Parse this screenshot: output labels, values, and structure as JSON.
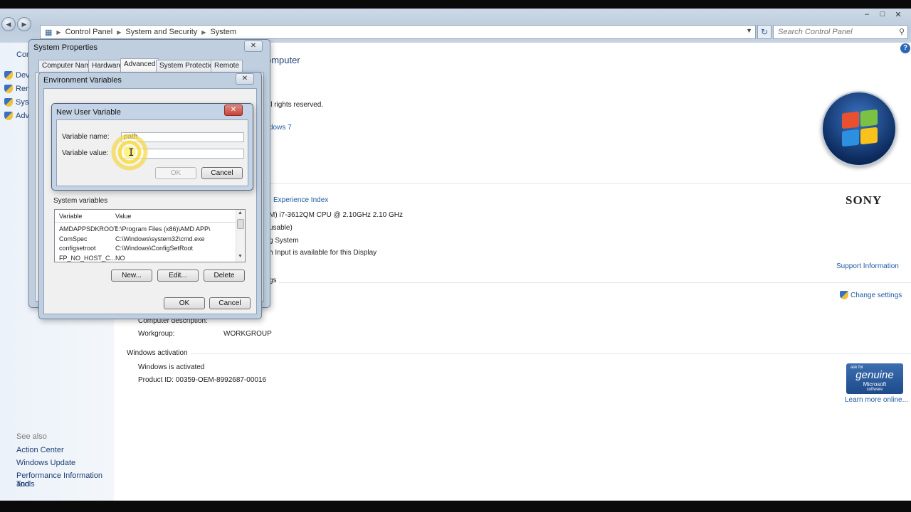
{
  "explorer": {
    "breadcrumb": [
      "Control Panel",
      "System and Security",
      "System"
    ],
    "search_placeholder": "Search Control Panel"
  },
  "left_pane": {
    "items": [
      "Devi",
      "Rem",
      "Syst",
      "Adv"
    ],
    "see_also_heading": "See also",
    "see_also": [
      "Action Center",
      "Windows Update",
      "Performance Information and",
      "Tools"
    ]
  },
  "main": {
    "heading_fragment": "omputer",
    "copyright_fragment": "ll rights reserved.",
    "sp_link_fragment": "dows 7",
    "wei_link_fragment": "Experience Index",
    "processor": "M) i7-3612QM CPU @ 2.10GHz   2.10 GHz",
    "ram_fragment": "usable)",
    "system_type_fragment": "g System",
    "pen_fragment": "h Input is available for this Display",
    "settings_fragment": "gs",
    "support_link": "Support Information",
    "change_settings": "Change settings",
    "brand": "SONY",
    "computer_description_label": "Computer description:",
    "workgroup_label": "Workgroup:",
    "workgroup_value": "WORKGROUP",
    "activation_heading": "Windows activation",
    "activation_status": "Windows is activated",
    "product_id": "Product ID: 00359-OEM-8992687-00016",
    "learn_more": "Learn more online...",
    "genuine": {
      "small": "ask for",
      "big": "genuine",
      "ms": "Microsoft",
      "sw": "software"
    }
  },
  "system_properties": {
    "title": "System Properties",
    "tabs": [
      "Computer Name",
      "Hardware",
      "Advanced",
      "System Protection",
      "Remote"
    ],
    "active_tab": "Advanced"
  },
  "env_vars": {
    "title": "Environment Variables",
    "system_vars_label": "System variables",
    "columns": [
      "Variable",
      "Value"
    ],
    "rows": [
      {
        "variable": "AMDAPPSDKROOT",
        "value": "c:\\Program Files (x86)\\AMD APP\\"
      },
      {
        "variable": "ComSpec",
        "value": "C:\\Windows\\system32\\cmd.exe"
      },
      {
        "variable": "configsetroot",
        "value": "C:\\Windows\\ConfigSetRoot"
      },
      {
        "variable": "FP_NO_HOST_C...",
        "value": "NO"
      }
    ],
    "new_button": "New...",
    "edit_button": "Edit...",
    "delete_button": "Delete",
    "ok_button": "OK",
    "cancel_button": "Cancel"
  },
  "new_user_var": {
    "title": "New User Variable",
    "name_label": "Variable name:",
    "name_value": "path",
    "value_label": "Variable value:",
    "value_value": "",
    "ok_button": "OK",
    "cancel_button": "Cancel"
  },
  "colors": {
    "link": "#1e5aa0",
    "dialog_frame": "#bfcfe0",
    "close_red": "#c7443a"
  }
}
